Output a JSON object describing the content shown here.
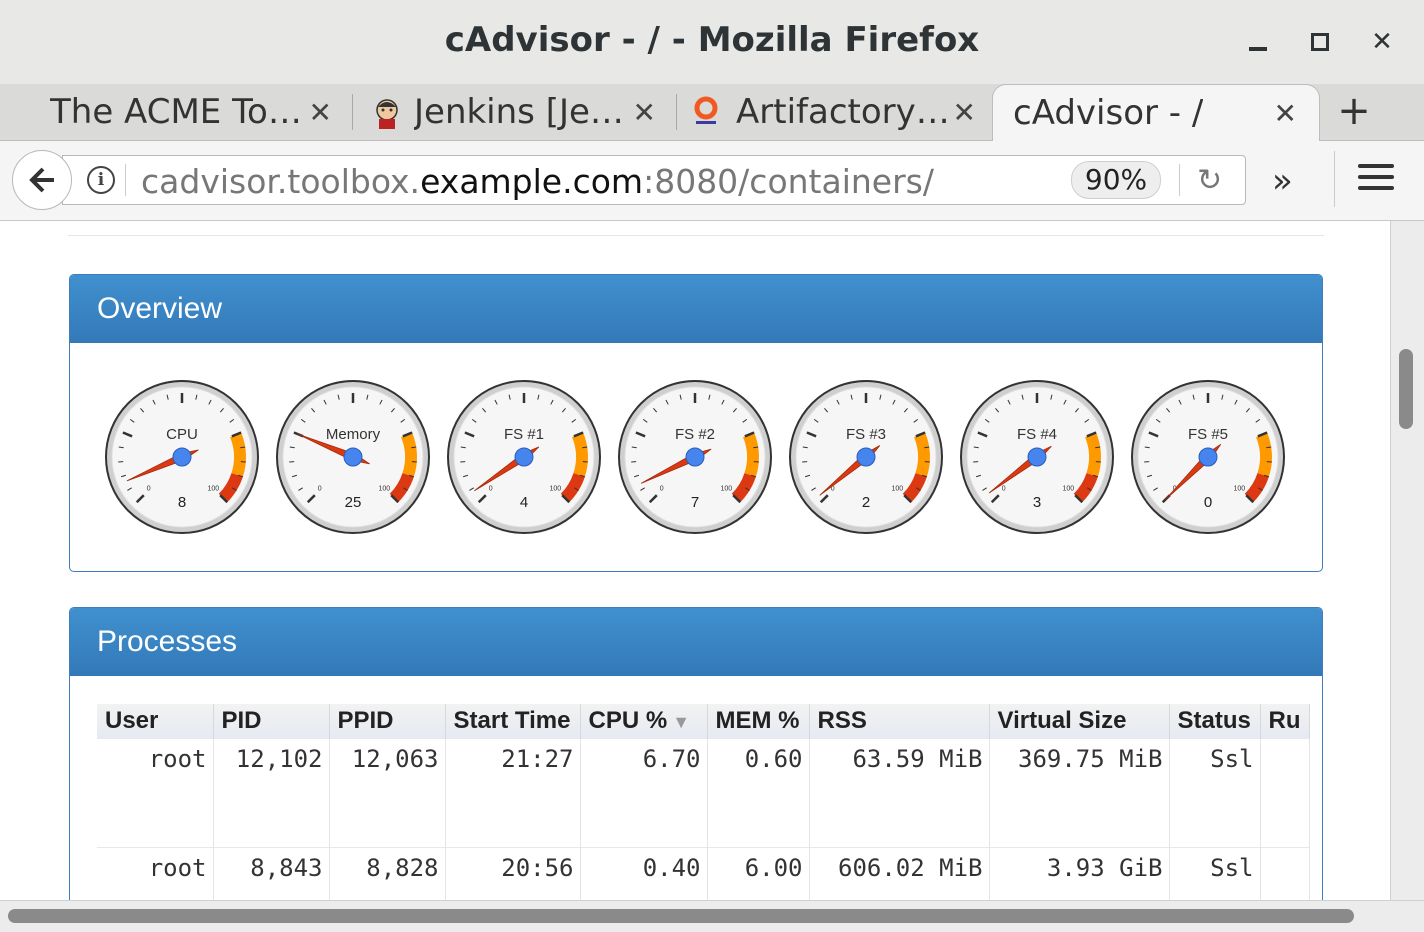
{
  "window": {
    "title": "cAdvisor - / - Mozilla Firefox",
    "controls": [
      "minimize",
      "maximize",
      "close"
    ]
  },
  "tabs": [
    {
      "label": "The ACME To…",
      "icon": "none",
      "active": false
    },
    {
      "label": "Jenkins [Je…",
      "icon": "jenkins-icon",
      "active": false
    },
    {
      "label": "Artifactory…",
      "icon": "artifactory-icon",
      "active": false
    },
    {
      "label": "cAdvisor - /",
      "icon": "none",
      "active": true
    }
  ],
  "nav": {
    "url_prefix": "cadvisor.toolbox.",
    "url_domain": "example.com",
    "url_suffix": ":8080/containers/",
    "zoom": "90%"
  },
  "overview": {
    "title": "Overview",
    "gauges": [
      {
        "label": "CPU",
        "value": "8",
        "scale_min": "0",
        "scale_max": "100"
      },
      {
        "label": "Memory",
        "value": "25",
        "scale_min": "0",
        "scale_max": "100"
      },
      {
        "label": "FS #1",
        "value": "4",
        "scale_min": "0",
        "scale_max": "100"
      },
      {
        "label": "FS #2",
        "value": "7",
        "scale_min": "0",
        "scale_max": "100"
      },
      {
        "label": "FS #3",
        "value": "2",
        "scale_min": "0",
        "scale_max": "100"
      },
      {
        "label": "FS #4",
        "value": "3",
        "scale_min": "0",
        "scale_max": "100"
      },
      {
        "label": "FS #5",
        "value": "0",
        "scale_min": "0",
        "scale_max": "100"
      }
    ]
  },
  "processes": {
    "title": "Processes",
    "columns": [
      "User",
      "PID",
      "PPID",
      "Start Time",
      "CPU %",
      "MEM %",
      "RSS",
      "Virtual Size",
      "Status",
      "Ru"
    ],
    "sort_indicator": "▼",
    "rows": [
      [
        "root",
        "12,102",
        "12,063",
        "21:27",
        "6.70",
        "0.60",
        "63.59 MiB",
        "369.75 MiB",
        "Ssl",
        ""
      ],
      [
        "root",
        "8,843",
        "8,828",
        "20:56",
        "0.40",
        "6.00",
        "606.02 MiB",
        "3.93 GiB",
        "Ssl",
        ""
      ]
    ]
  },
  "colors": {
    "panel_header": "#3a83c4",
    "gauge_yellow": "#ff9900",
    "gauge_red": "#dc3912",
    "needle": "#dc3912",
    "needle_hub": "#4684ee"
  }
}
